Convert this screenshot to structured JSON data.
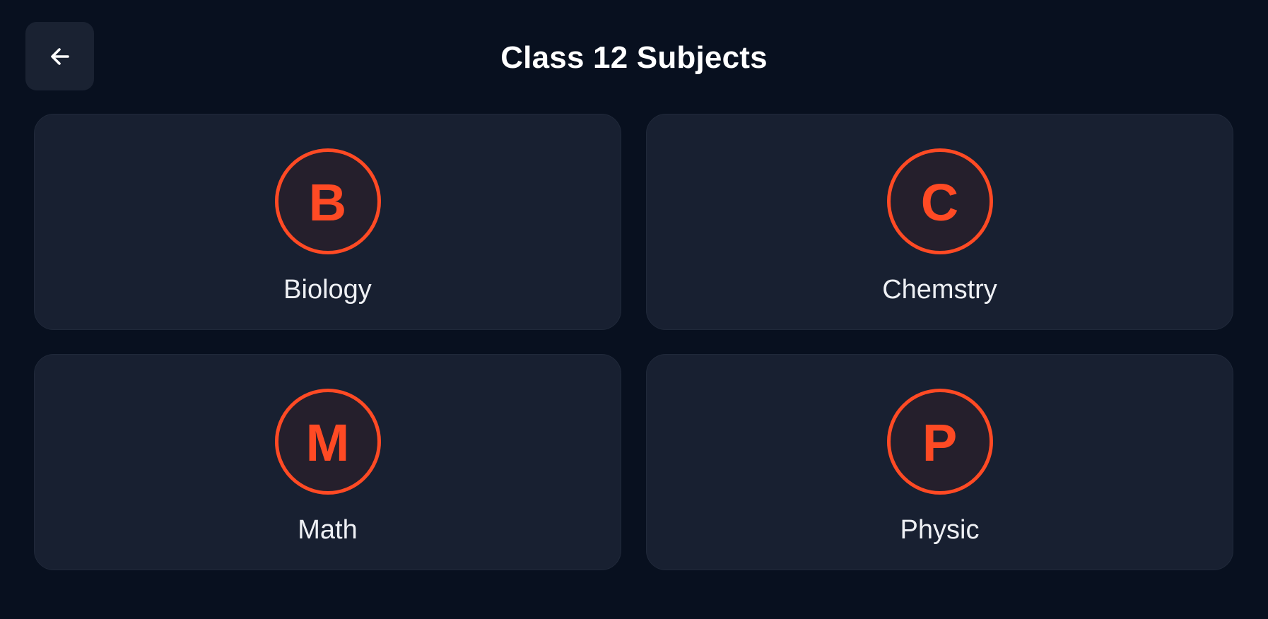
{
  "header": {
    "back_icon": "arrow-left-icon",
    "title": "Class 12 Subjects"
  },
  "theme": {
    "background": "#08101f",
    "card_background": "#182031",
    "accent": "#ff4a24",
    "text": "#ffffff"
  },
  "subjects": [
    {
      "letter": "B",
      "label": "Biology"
    },
    {
      "letter": "C",
      "label": "Chemstry"
    },
    {
      "letter": "M",
      "label": "Math"
    },
    {
      "letter": "P",
      "label": "Physic"
    }
  ]
}
